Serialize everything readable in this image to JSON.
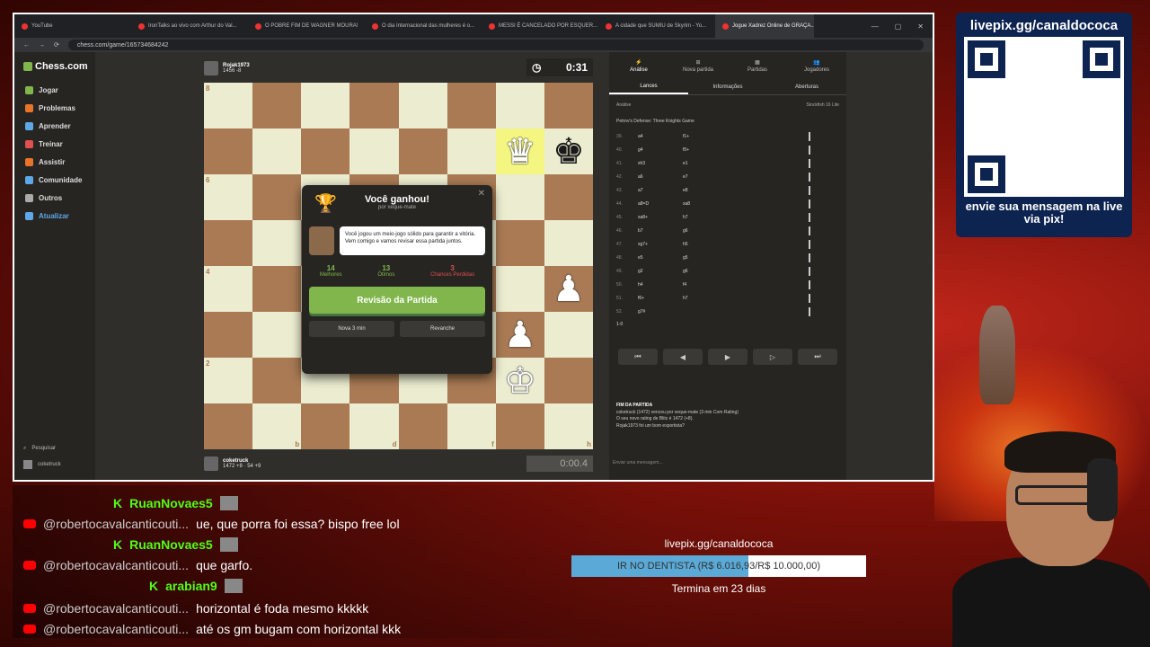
{
  "browser": {
    "tabs": [
      {
        "title": "YouTube",
        "active": false
      },
      {
        "title": "IronTalks ao vivo com Arthur do Val...",
        "active": false
      },
      {
        "title": "O POBRE FIM DE WAGNER MOURA!",
        "active": false
      },
      {
        "title": "O dia Internacional das mulheres é o...",
        "active": false
      },
      {
        "title": "MESSI É CANCELADO POR ESQUER...",
        "active": false
      },
      {
        "title": "A cidade que SUMIU de Skyrim - Yo...",
        "active": false
      },
      {
        "title": "Jogue Xadrez Online de GRAÇA...",
        "active": true
      }
    ],
    "url": "chess.com/game/165734684242"
  },
  "sidebar": {
    "logo": "Chess.com",
    "items": [
      {
        "label": "Jogar",
        "color": "#81b64c"
      },
      {
        "label": "Problemas",
        "color": "#e8742c"
      },
      {
        "label": "Aprender",
        "color": "#5fa8e8"
      },
      {
        "label": "Treinar",
        "color": "#e05050"
      },
      {
        "label": "Assistir",
        "color": "#e8742c"
      },
      {
        "label": "Comunidade",
        "color": "#5fa8e8"
      },
      {
        "label": "Outros",
        "color": "#aaaaaa"
      },
      {
        "label": "Atualizar",
        "color": "#5fa8e8"
      }
    ],
    "search": "Pesquisar",
    "user": "coketruck"
  },
  "top_player": {
    "name": "Rojak1973",
    "rating": "1456 -8"
  },
  "bottom_player": {
    "name": "coketruck",
    "rating": "1472 +8",
    "stats": "54 +9"
  },
  "clocks": {
    "top": "0:31",
    "bottom": "0:00.4"
  },
  "board": {
    "ranks": [
      "8",
      "7",
      "6",
      "5",
      "4",
      "3",
      "2",
      "1"
    ],
    "files": [
      "a",
      "b",
      "c",
      "d",
      "e",
      "f",
      "g",
      "h"
    ],
    "pieces": [
      {
        "sq": "g7",
        "glyph": "♛",
        "color": "white"
      },
      {
        "sq": "h7",
        "glyph": "♚",
        "color": "black"
      },
      {
        "sq": "h4",
        "glyph": "♟",
        "color": "white"
      },
      {
        "sq": "g3",
        "glyph": "♟",
        "color": "white"
      },
      {
        "sq": "g2",
        "glyph": "♔",
        "color": "white"
      }
    ],
    "highlight": [
      "g7"
    ]
  },
  "modal": {
    "title": "Você ganhou!",
    "subtitle": "por xeque-mate",
    "coach_text": "Você jogou um meio-jogo sólido para garantir a vitória. Vem comigo e vamos revisar essa partida juntos.",
    "stats": [
      {
        "value": "14",
        "label": "Melhores",
        "kind": "g"
      },
      {
        "value": "13",
        "label": "Ótimos",
        "kind": "g"
      },
      {
        "value": "3",
        "label": "Chances Perdidas",
        "kind": "r"
      }
    ],
    "review_button": "Revisão da Partida",
    "new_button": "Nova 3 min",
    "rematch_button": "Revanche"
  },
  "panel": {
    "tabs": [
      "Análise",
      "Nova partida",
      "Partidas",
      "Jogadores"
    ],
    "subtabs": [
      "Lances",
      "Informações",
      "Aberturas"
    ],
    "analysis_label": "Análise",
    "engine": "Stockfish 16 Lite",
    "opening": "Petrov's Defense: Three Knights Game",
    "moves": [
      {
        "n": "39.",
        "w": "a4",
        "b": "f1+"
      },
      {
        "n": "40.",
        "w": "g4",
        "b": "f5+"
      },
      {
        "n": "41.",
        "w": "xh3",
        "b": "e1"
      },
      {
        "n": "42.",
        "w": "a6",
        "b": "e7"
      },
      {
        "n": "43.",
        "w": "a7",
        "b": "e8"
      },
      {
        "n": "44.",
        "w": "a8=D",
        "b": "xa8"
      },
      {
        "n": "45.",
        "w": "xa8+",
        "b": "h7"
      },
      {
        "n": "46.",
        "w": "b7",
        "b": "g6"
      },
      {
        "n": "47.",
        "w": "xg7+",
        "b": "h5"
      },
      {
        "n": "48.",
        "w": "e5",
        "b": "g5"
      },
      {
        "n": "49.",
        "w": "g2",
        "b": "g6"
      },
      {
        "n": "50.",
        "w": "h4",
        "b": "f4"
      },
      {
        "n": "51.",
        "w": "f6+",
        "b": "h7"
      },
      {
        "n": "52.",
        "w": "g7#",
        "b": ""
      }
    ],
    "result": "1-0",
    "game_over_title": "FIM DA PARTIDA",
    "game_over_line1": "coketruck (1472) venceu por xeque-mate (3 min Com Rating)",
    "game_over_line2": "O seu novo rating de Blitz é 1472 (+8).",
    "game_over_line3": "Rojak1973 foi um bom esportista?",
    "message_placeholder": "Enviar uma mensagem..."
  },
  "qr": {
    "title": "livepix.gg/canaldococa",
    "caption": "envie sua mensagem na live via pix!"
  },
  "chat": [
    {
      "platform": "kick",
      "user": "RuanNovaes5",
      "text": ""
    },
    {
      "platform": "youtube",
      "user": "@robertocavalcanticouti...",
      "text": "ue, que porra foi essa? bispo free lol"
    },
    {
      "platform": "kick",
      "user": "RuanNovaes5",
      "text": ""
    },
    {
      "platform": "youtube",
      "user": "@robertocavalcanticouti...",
      "text": "que garfo."
    },
    {
      "platform": "kick",
      "user": "arabian9",
      "text": ""
    },
    {
      "platform": "youtube",
      "user": "@robertocavalcanticouti...",
      "text": "horizontal é foda mesmo kkkkk"
    },
    {
      "platform": "youtube",
      "user": "@robertocavalcanticouti...",
      "text": "até os gm bugam com horizontal kkk"
    }
  ],
  "goal": {
    "url": "livepix.gg/canaldococa",
    "label": "IR NO DENTISTA (R$ 6.016,93/R$ 10.000,00)",
    "progress": 0.6017,
    "deadline": "Termina em 23 dias"
  }
}
